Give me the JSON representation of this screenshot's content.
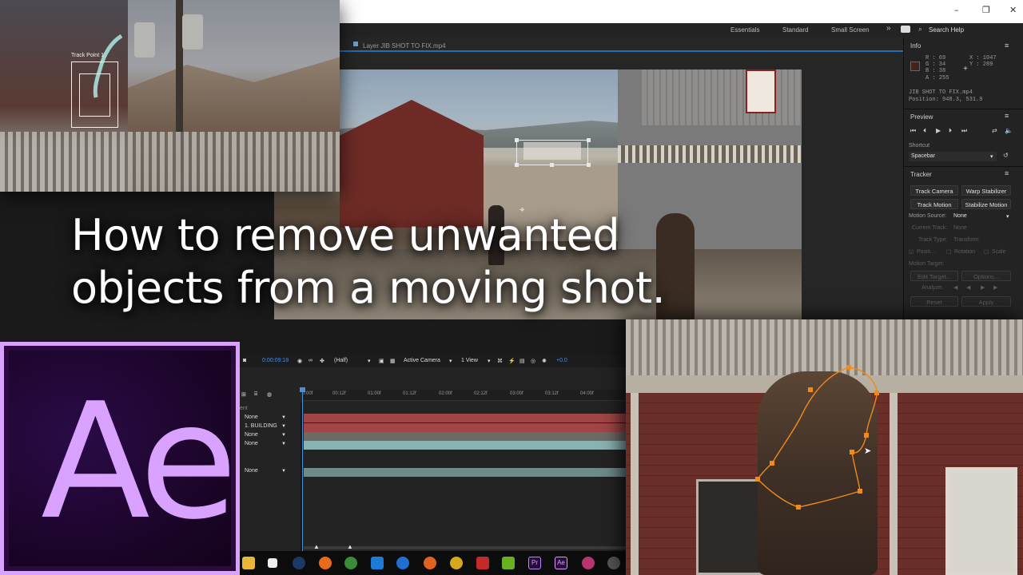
{
  "app": {
    "window_controls": [
      "–",
      "❐",
      "✕"
    ],
    "workspaces": [
      "Essentials",
      "Standard",
      "Small Screen"
    ],
    "workspace_overflow": "»",
    "search_placeholder": "Search Help"
  },
  "layer_panel": {
    "tab_label": "Layer JIB SHOT TO FIX.mp4"
  },
  "info_panel": {
    "title": "Info",
    "r": "R : 69",
    "g": "G : 34",
    "b": "B : 38",
    "a": "A : 255",
    "x": "X : 1047",
    "y": "Y : 289",
    "layer_name": "JIB SHOT TO FIX.mp4",
    "position": "Position: 948.3, 531.9",
    "swatch_color": "#45221e"
  },
  "preview_panel": {
    "title": "Preview",
    "shortcut_label": "Shortcut",
    "shortcut_value": "Spacebar"
  },
  "tracker_panel": {
    "title": "Tracker",
    "track_camera": "Track Camera",
    "warp_stabilizer": "Warp Stabilizer",
    "track_motion": "Track Motion",
    "stabilize_motion": "Stabilize Motion",
    "motion_source_label": "Motion Source:",
    "motion_source_value": "None",
    "current_track_label": "Current Track:",
    "current_track_value": "None",
    "track_type_label": "Track Type:",
    "track_type_value": "Transform",
    "position_label": "Positi...",
    "rotation_label": "Rotation",
    "scale_label": "Scale",
    "motion_target_label": "Motion Target:",
    "edit_target": "Edit Target...",
    "options": "Options...",
    "analyze_label": "Analyze:",
    "reset": "Reset",
    "apply": "Apply"
  },
  "overlay": {
    "track_point_label": "Track Point 1",
    "headline_line1": "How to remove unwanted",
    "headline_line2": "objects from a moving shot."
  },
  "timeline": {
    "timecode": "0:00:09:18",
    "resolution": "(Half)",
    "camera": "Active Camera",
    "views": "1 View",
    "exposure": "+0.0",
    "ruler_ticks": [
      "0:00f",
      "00:12f",
      "01:00f",
      "01:12f",
      "02:00f",
      "02:12f",
      "03:00f",
      "03:12f",
      "04:00f"
    ],
    "parent_header": "ent",
    "rows": [
      {
        "parent": "None",
        "bar_color": "#a04646"
      },
      {
        "parent": "1. BUILDING",
        "bar_color": "#a04646"
      },
      {
        "parent": "None",
        "bar_color": "#6d6a66"
      },
      {
        "parent": "None",
        "bar_color": "#8ab2b0"
      },
      {
        "parent": "None",
        "bar_color": "#6f8a88"
      }
    ]
  },
  "logo": {
    "text": "Ae",
    "accent_color": "#d9a2ff"
  },
  "taskbar": {
    "apps": [
      "file-explorer-icon",
      "store-icon",
      "steam-icon",
      "app-icon-orange",
      "xbox-icon",
      "outlook-icon",
      "edge-icon",
      "firefox-icon",
      "chrome-icon",
      "app-icon-red",
      "nvidia-icon",
      "premiere-icon",
      "after-effects-icon",
      "davinci-icon",
      "misc-icon"
    ],
    "premiere_label": "Pr",
    "ae_label": "Ae"
  }
}
